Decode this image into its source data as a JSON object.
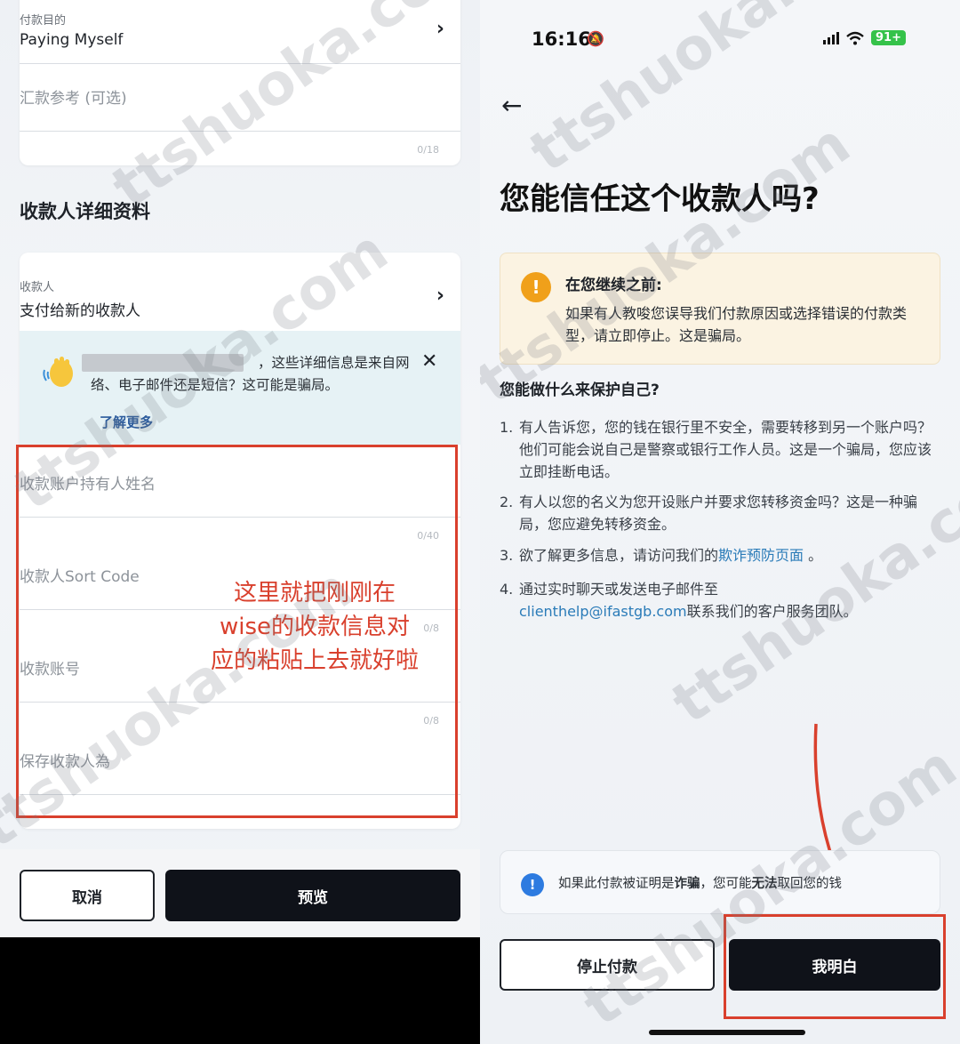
{
  "left": {
    "payment_purpose_label": "付款目的",
    "payment_purpose_value": "Paying Myself",
    "remittance_ref_placeholder": "汇款参考 (可选)",
    "remittance_ref_counter": "0/18",
    "section_title": "收款人详细资料",
    "recipient_label": "收款人",
    "recipient_value": "支付给新的收款人",
    "warning_text": "，这些详细信息是来自网络、电子邮件还是短信？这可能是骗局。",
    "learn_more": "了解更多",
    "fields": [
      {
        "placeholder": "收款账户持有人姓名",
        "counter": "0/40"
      },
      {
        "placeholder": "收款人Sort Code",
        "counter": "0/8"
      },
      {
        "placeholder": "收款账号",
        "counter": "0/8"
      },
      {
        "placeholder": "保存收款人為",
        "counter": ""
      }
    ],
    "annotation": "这里就把刚刚在wise的收款信息对应的粘贴上去就好啦",
    "cancel_button": "取消",
    "preview_button": "预览"
  },
  "right": {
    "status_time": "16:16",
    "battery": "91+",
    "title": "您能信任这个收款人吗?",
    "notice_title": "在您继续之前:",
    "notice_body": "如果有人教唆您误导我们付款原因或选择错误的付款类型，请立即停止。这是骗局。",
    "protect_title": "您能做什么来保护自己?",
    "tips": [
      {
        "num": "1.",
        "text": "有人告诉您，您的钱在银行里不安全，需要转移到另一个账户吗？他们可能会说自己是警察或银行工作人员。这是一个骗局，您应该立即挂断电话。"
      },
      {
        "num": "2.",
        "text": "有人以您的名义为您开设账户并要求您转移资金吗？这是一种骗局，您应避免转移资金。"
      },
      {
        "num": "3.",
        "text_before": "欲了解更多信息，请访问我们的",
        "link": "欺诈预防页面",
        "text_after": "。"
      },
      {
        "num": "4.",
        "text_before": "通过实时聊天或发送电子邮件至",
        "link": "clienthelp@ifastgb.com",
        "text_after": "联系我们的客户服务团队。"
      }
    ],
    "info_prefix": "如果此付款被证明是",
    "info_bold1": "诈骗",
    "info_middle": "，您可能",
    "info_bold2": "无法",
    "info_suffix": "取回您的钱",
    "stop_button": "停止付款",
    "understand_button": "我明白"
  },
  "watermark": "ttshuoka.com",
  "colors": {
    "annotation_red": "#d9402d",
    "primary_dark": "#0f1219",
    "link_blue": "#2a7bb8",
    "warn_orange": "#f0a01a",
    "battery_green": "#35c24a"
  }
}
